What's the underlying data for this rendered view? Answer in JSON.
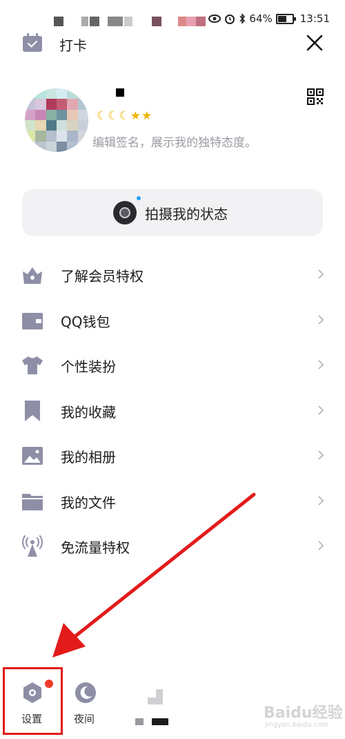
{
  "status_bar": {
    "battery": "64%",
    "time": "13:51"
  },
  "header": {
    "checkin_label": "打卡"
  },
  "profile": {
    "badges": "☾☾☾★★",
    "signature": "编辑签名，展示我的独特态度。"
  },
  "status_button": {
    "label": "拍摄我的状态"
  },
  "menu": {
    "items": [
      {
        "label": "了解会员特权",
        "icon": "crown-icon"
      },
      {
        "label": "QQ钱包",
        "icon": "wallet-icon"
      },
      {
        "label": "个性装扮",
        "icon": "tshirt-icon"
      },
      {
        "label": "我的收藏",
        "icon": "bookmark-icon"
      },
      {
        "label": "我的相册",
        "icon": "photo-album-icon"
      },
      {
        "label": "我的文件",
        "icon": "folder-icon"
      },
      {
        "label": "免流量特权",
        "icon": "signal-tower-icon"
      }
    ]
  },
  "bottom_bar": {
    "settings_label": "设置",
    "night_label": "夜间"
  },
  "watermark": {
    "brand": "Baidu经验",
    "url": "jingyan.baidu.com"
  },
  "colors": {
    "icon_gray": "#8e8fa6",
    "accent_red": "#e31b1b",
    "dot_blue": "#1fa3f5",
    "badge_gold": "#f0b400"
  }
}
